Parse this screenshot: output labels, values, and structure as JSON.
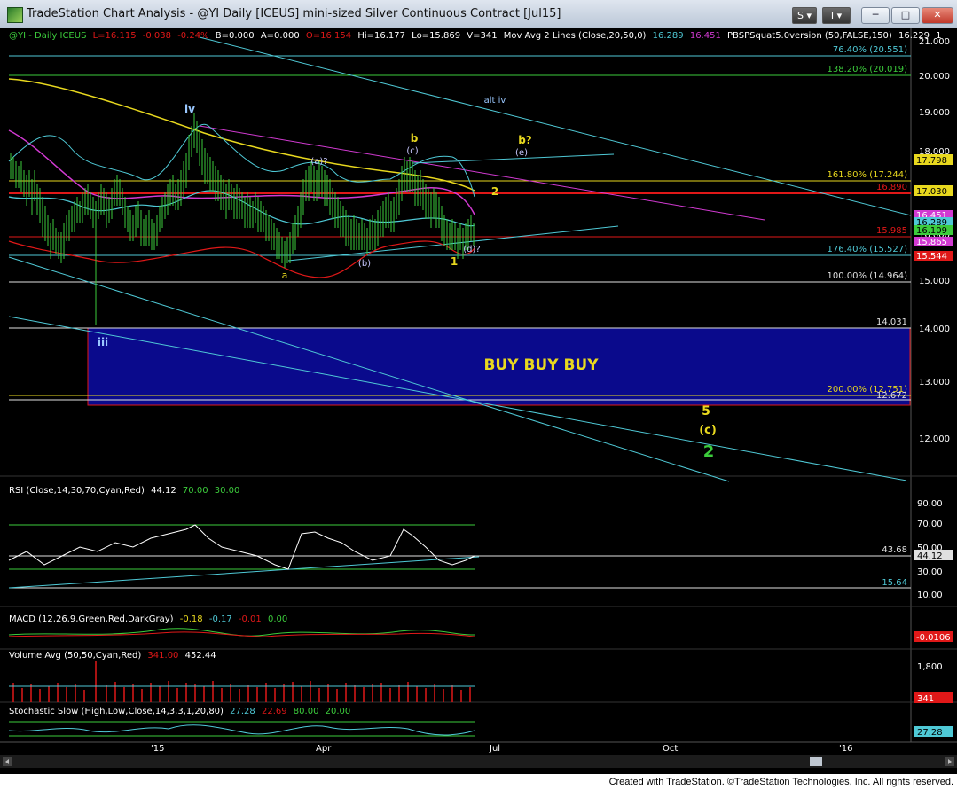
{
  "window": {
    "title": "TradeStation Chart Analysis - @YI Daily [ICEUS] mini-sized Silver Continuous Contract [Jul15]",
    "btn_s": "S",
    "btn_i": "I",
    "minimize": "─",
    "maximize": "□",
    "close": "✕"
  },
  "colors": {
    "background": "#000000",
    "cyan": "#4fc9d6",
    "magenta": "#d23ad2",
    "red": "#e01818",
    "yellow": "#e8d81e",
    "green": "#3ccc3c",
    "buy_zone": "#0a0a8c"
  },
  "header": {
    "symbol": "@YI - Daily  ICEUS",
    "last": "L=16.115",
    "change": "-0.038",
    "pct": "-0.24%",
    "bid": "B=0.000",
    "ask": "A=0.000",
    "open": "O=16.154",
    "hi": "Hi=16.177",
    "lo": "Lo=15.869",
    "vol": "V=341",
    "ma_label": "Mov Avg 2 Lines (Close,20,50,0)",
    "ma1": "16.289",
    "ma2": "16.451",
    "pbs_label": "PBSPSquat5.0version (50,FALSE,150)",
    "pbs1": "16.229",
    "pbs2": "1"
  },
  "chart_data": {
    "type": "candlestick",
    "title": "@YI Daily mini-sized Silver Continuous Contract [Jul15]",
    "x_tick_labels": [
      "'15",
      "Apr",
      "Jul",
      "Oct",
      "'16"
    ],
    "y_tick_labels": [
      "21.000",
      "20.000",
      "19.000",
      "18.000",
      "17.000",
      "16.000",
      "15.000",
      "14.000",
      "13.000",
      "12.000"
    ],
    "price_tags": [
      {
        "value": "17.798",
        "color": "#e8d81e"
      },
      {
        "value": "17.030",
        "color": "#e8d81e"
      },
      {
        "value": "16.451",
        "color": "#d23ad2"
      },
      {
        "value": "16.289",
        "color": "#4fc9d6"
      },
      {
        "value": "16.109",
        "color": "#3ccc3c"
      },
      {
        "value": "15.865",
        "color": "#d23ad2"
      },
      {
        "value": "15.544",
        "color": "#e01818"
      }
    ],
    "fib_levels": [
      {
        "label": "76.40% (20.551)",
        "color": "#4fc9d6"
      },
      {
        "label": "138.20% (20.019)",
        "color": "#3ccc3c"
      },
      {
        "label": "161.80% (17.244)",
        "color": "#e8d81e"
      },
      {
        "label": "176.40% (15.527)",
        "color": "#4fc9d6"
      },
      {
        "label": "100.00% (14.964)",
        "color": "#e0e0e0"
      },
      {
        "label": "200.00% (12.751)",
        "color": "#e8d81e"
      }
    ],
    "level_labels": [
      "16.890",
      "15.985",
      "14.031",
      "12.672"
    ],
    "annotations": [
      {
        "text": "iv",
        "color": "#9ac8ff"
      },
      {
        "text": "alt iv",
        "color": "#9ac8ff"
      },
      {
        "text": "b",
        "color": "#e8d81e"
      },
      {
        "text": "(c)",
        "color": "#c8c8ff"
      },
      {
        "text": "b?",
        "color": "#e8d81e"
      },
      {
        "text": "(e)",
        "color": "#c8c8ff"
      },
      {
        "text": "(a)?",
        "color": "#c8c8ff"
      },
      {
        "text": "2",
        "color": "#e8d81e"
      },
      {
        "text": "(b)",
        "color": "#c8c8ff"
      },
      {
        "text": "a",
        "color": "#e8d81e"
      },
      {
        "text": "1",
        "color": "#e8d81e"
      },
      {
        "text": "(d)?",
        "color": "#c8c8ff"
      },
      {
        "text": "iii",
        "color": "#9ac8ff"
      },
      {
        "text": "5",
        "color": "#e8d81e"
      },
      {
        "text": "(c)",
        "color": "#e8d81e"
      },
      {
        "text": "2",
        "color": "#3ccc3c"
      }
    ],
    "buy_zone_label": "BUY BUY BUY"
  },
  "rsi": {
    "label": "RSI (Close,14,30,70,Cyan,Red)",
    "v1": "44.12",
    "v2": "70.00",
    "v3": "30.00",
    "ticks": [
      "90.00",
      "70.00",
      "50.00",
      "30.00",
      "10.00"
    ],
    "current": "44.12",
    "level_1": "43.68",
    "level_2": "15.64"
  },
  "macd": {
    "label": "MACD (12,26,9,Green,Red,DarkGray)",
    "v1": "-0.18",
    "v2": "-0.17",
    "v3": "-0.01",
    "v4": "0.00",
    "tag": "-0.0106"
  },
  "volume": {
    "label": "Volume Avg (50,50,Cyan,Red)",
    "v1": "341.00",
    "v2": "452.44",
    "tick": "1,800",
    "tag": "341"
  },
  "stoch": {
    "label": "Stochastic Slow (High,Low,Close,14,3,3,1,20,80)",
    "v1": "27.28",
    "v2": "22.69",
    "v3": "80.00",
    "v4": "20.00",
    "tag": "27.28"
  },
  "footer": {
    "text": "Created with TradeStation. ©TradeStation Technologies, Inc. All rights reserved."
  }
}
